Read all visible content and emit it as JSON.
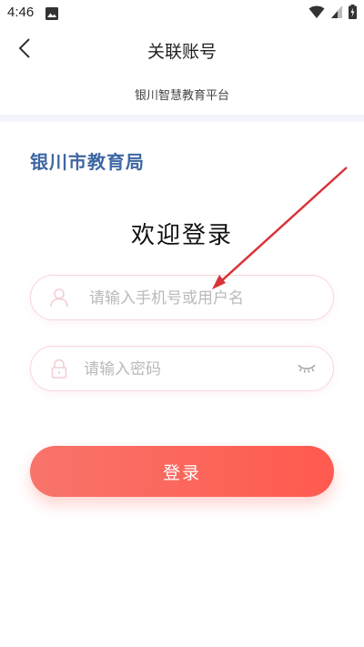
{
  "status_bar": {
    "time": "4:46",
    "icons": [
      "image-icon",
      "wifi-icon",
      "signal-icon",
      "battery-charging-icon"
    ]
  },
  "header": {
    "title": "关联账号",
    "subtitle": "银川智慧教育平台",
    "back_icon": "back-arrow-icon"
  },
  "org": {
    "name": "银川市教育局"
  },
  "login": {
    "welcome": "欢迎登录",
    "username_placeholder": "请输入手机号或用户名",
    "username_value": "",
    "password_placeholder": "请输入密码",
    "password_value": "",
    "submit_label": "登录"
  },
  "colors": {
    "org_name": "#3f67a3",
    "button_gradient_start": "#f8746a",
    "button_gradient_end": "#ff5a4f",
    "field_border": "#f7d7dc",
    "annotation_arrow": "#d9333a"
  }
}
